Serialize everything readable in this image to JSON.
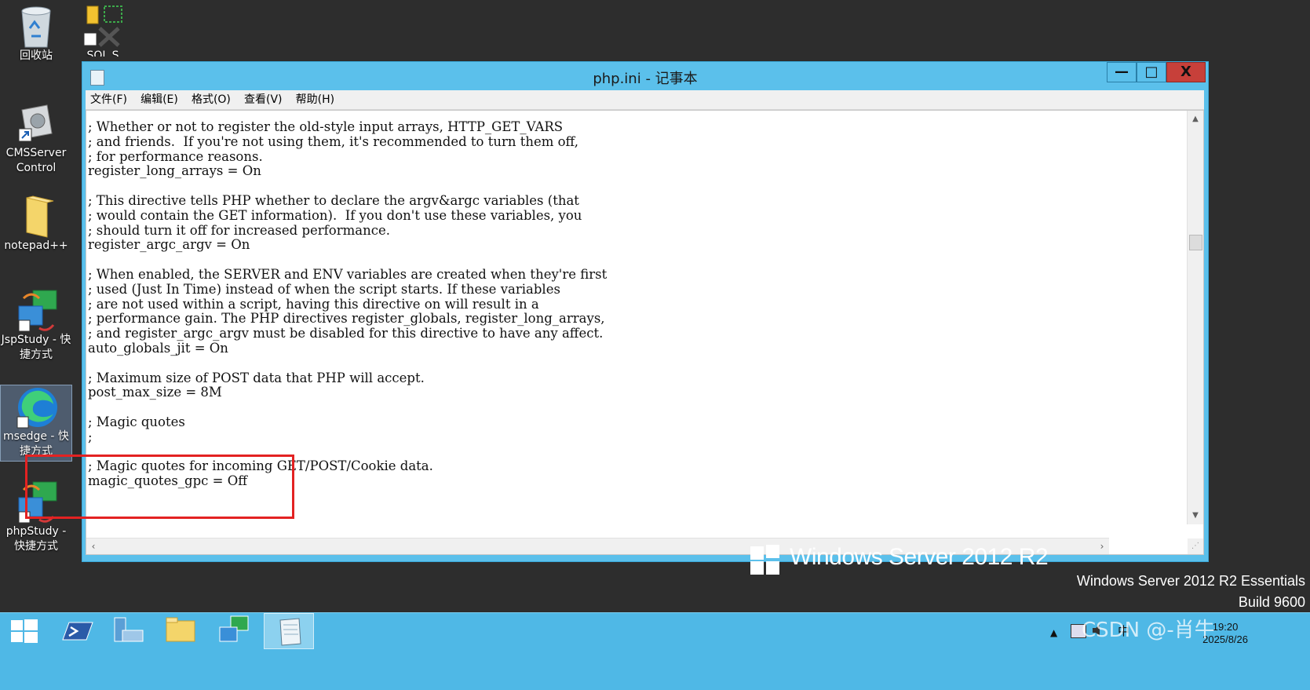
{
  "desktop": {
    "icons": [
      {
        "label": "回收站",
        "icon": "recycle-bin-icon"
      },
      {
        "label": "SQL S",
        "icon": "sql-tools-icon"
      },
      {
        "label": "CMSServer Control",
        "icon": "cmsserver-control-icon"
      },
      {
        "label": "notepad++",
        "icon": "folder-icon"
      },
      {
        "label": "JspStudy - 快捷方式",
        "icon": "jspstudy-icon"
      },
      {
        "label": "msedge - 快捷方式",
        "icon": "edge-icon"
      },
      {
        "label": "phpStudy - 快捷方式",
        "icon": "phpstudy-icon"
      }
    ]
  },
  "window": {
    "title": "php.ini - 记事本",
    "minimize": "—",
    "maximize": "□",
    "close": "X",
    "menu": [
      "文件(F)",
      "编辑(E)",
      "格式(O)",
      "查看(V)",
      "帮助(H)"
    ],
    "content": "; Whether or not to register the old-style input arrays, HTTP_GET_VARS\n; and friends.  If you're not using them, it's recommended to turn them off,\n; for performance reasons.\nregister_long_arrays = On\n\n; This directive tells PHP whether to declare the argv&argc variables (that\n; would contain the GET information).  If you don't use these variables, you\n; should turn it off for increased performance.\nregister_argc_argv = On\n\n; When enabled, the SERVER and ENV variables are created when they're first\n; used (Just In Time) instead of when the script starts. If these variables\n; are not used within a script, having this directive on will result in a\n; performance gain. The PHP directives register_globals, register_long_arrays,\n; and register_argc_argv must be disabled for this directive to have any affect.\nauto_globals_jit = On\n\n; Maximum size of POST data that PHP will accept.\npost_max_size = 8M\n\n; Magic quotes\n;\n\n; Magic quotes for incoming GET/POST/Cookie data.\nmagic_quotes_gpc = Off"
  },
  "branding": {
    "logo_text": "Windows Server 2012 R2",
    "edition": "Windows Server 2012 R2 Essentials",
    "build": "Build 9600"
  },
  "taskbar": {
    "buttons": [
      "start-icon",
      "powershell-icon",
      "server-manager-icon",
      "file-explorer-icon",
      "remote-desktop-icon",
      "notepad-icon"
    ],
    "time": "19:20",
    "date": "2025/8/26",
    "ime": "中"
  },
  "watermark": "CSDN @-肖牛",
  "colors": {
    "accent": "#5bc0eb",
    "close": "#c7403a",
    "highlight": "#e32222",
    "desktop": "#2d2d2d"
  }
}
